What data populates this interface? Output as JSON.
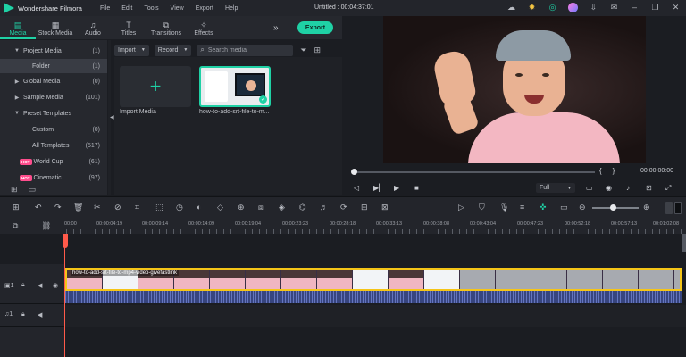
{
  "app": {
    "name": "Wondershare Filmora",
    "menu": [
      "File",
      "Edit",
      "Tools",
      "View",
      "Export",
      "Help"
    ],
    "doc_title": "Untitled : 00:04:37:01"
  },
  "top_tabs": [
    {
      "label": "Media",
      "icon": "folder-icon",
      "active": true
    },
    {
      "label": "Stock Media",
      "icon": "film-icon",
      "active": false
    },
    {
      "label": "Audio",
      "icon": "music-note-icon",
      "active": false
    },
    {
      "label": "Titles",
      "icon": "text-t-icon",
      "active": false
    },
    {
      "label": "Transitions",
      "icon": "transitions-icon",
      "active": false
    },
    {
      "label": "Effects",
      "icon": "effects-icon",
      "active": false
    }
  ],
  "export_label": "Export",
  "sidebar": {
    "items": [
      {
        "label": "Project Media",
        "count": "(1)"
      },
      {
        "label": "Folder",
        "count": "(1)"
      },
      {
        "label": "Global Media",
        "count": "(0)"
      },
      {
        "label": "Sample Media",
        "count": "(101)"
      },
      {
        "label": "Preset Templates",
        "count": ""
      },
      {
        "label": "Custom",
        "count": "(0)"
      },
      {
        "label": "All Templates",
        "count": "(517)"
      },
      {
        "label": "World Cup",
        "count": "(61)"
      },
      {
        "label": "Cinematic",
        "count": "(97)"
      }
    ],
    "hot_badge": "HOT"
  },
  "media_toolbar": {
    "import_label": "Import",
    "record_label": "Record",
    "search_placeholder": "Search media"
  },
  "media_items": {
    "import_label": "Import Media",
    "clip_label": "how-to-add-srt-file-to-m..."
  },
  "preview": {
    "timecode": "00:00:00:00",
    "quality": "Full"
  },
  "timeline": {
    "ruler_labels": [
      "00:00",
      "00:00:04:19",
      "00:00:09:14",
      "00:00:14:09",
      "00:00:19:04",
      "00:00:23:23",
      "00:00:28:18",
      "00:00:33:13",
      "00:00:38:08",
      "00:00:43:04",
      "00:00:47:23",
      "00:00:52:18",
      "00:00:57:13",
      "00:01:02:08"
    ],
    "clip_title": "how-to-add-srt-file-to-mp4-video-givefastlink",
    "video_track_label": "1",
    "audio_track_label": "1"
  }
}
